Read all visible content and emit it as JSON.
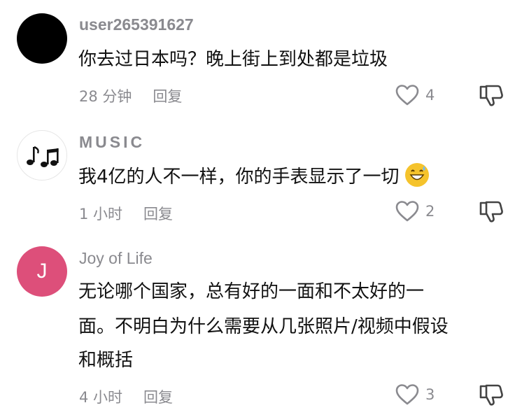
{
  "comments": [
    {
      "username": "user265391627",
      "text": "你去过日本吗？晚上街上到处都是垃圾",
      "time": "28 分钟",
      "reply_label": "回复",
      "likes": "4"
    },
    {
      "username": "MUSIC",
      "text": "我4亿的人不一样，你的手表显示了一切",
      "time": "1 小时",
      "reply_label": "回复",
      "likes": "2",
      "emoji": "grinning-sweat-emoji"
    },
    {
      "username": "Joy of Life",
      "avatar_letter": "J",
      "text_lines": [
        "无论哪个国家，总有好的一面和不太好的一",
        "面。不明白为什么需要从几张照片/视频中假设",
        "和概括"
      ],
      "time": "4 小时",
      "reply_label": "回复",
      "likes": "3"
    }
  ],
  "colors": {
    "muted": "#8a8a8f",
    "text": "#111111",
    "avatar_j": "#dd4f7a",
    "emoji": "#f5c32c"
  }
}
